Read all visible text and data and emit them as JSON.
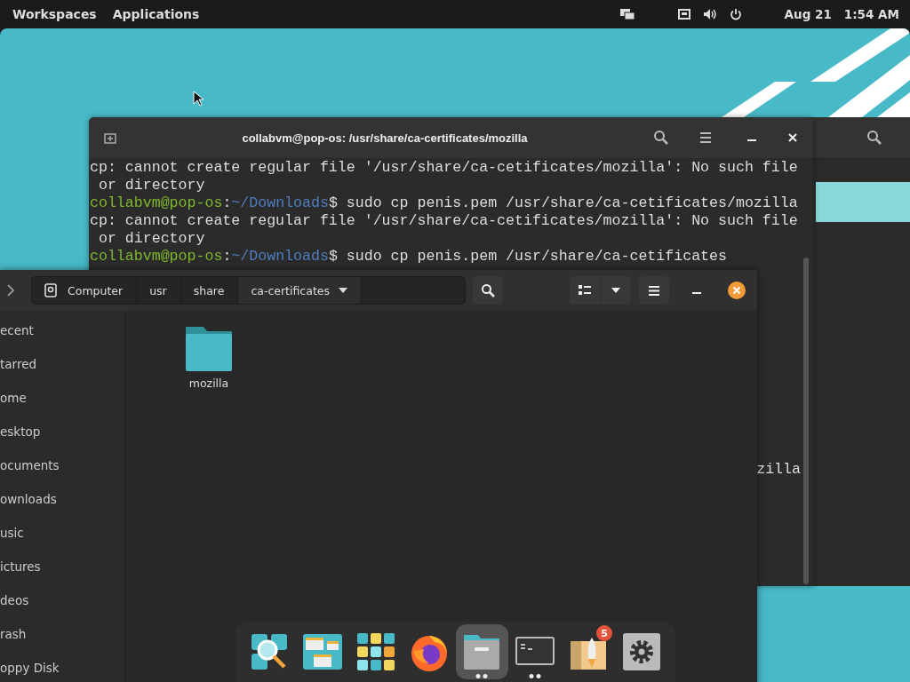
{
  "top_bar": {
    "workspaces": "Workspaces",
    "applications": "Applications",
    "date": "Aug 21",
    "time": "1:54 AM"
  },
  "terminal": {
    "title": "collabvm@pop-os: /usr/share/ca-certificates/mozilla",
    "lines": [
      {
        "kind": "output",
        "text": "cp: cannot create regular file '/usr/share/ca-cetificates/mozilla': No such file"
      },
      {
        "kind": "output",
        "text": " or directory"
      },
      {
        "kind": "prompt",
        "user": "collabvm@pop-os",
        "sep": ":",
        "path": "~/Downloads",
        "command": "$ sudo cp penis.pem /usr/share/ca-cetificates/mozilla"
      },
      {
        "kind": "output",
        "text": "cp: cannot create regular file '/usr/share/ca-cetificates/mozilla': No such file"
      },
      {
        "kind": "output",
        "text": " or directory"
      },
      {
        "kind": "prompt",
        "user": "collabvm@pop-os",
        "sep": ":",
        "path": "~/Downloads",
        "command": "$ sudo cp penis.pem /usr/share/ca-cetificates"
      }
    ],
    "partial_line": "zilla"
  },
  "file_manager": {
    "breadcrumbs": [
      {
        "label": "Computer",
        "kind": "drive",
        "selected": false
      },
      {
        "label": "usr",
        "kind": "folder",
        "selected": false
      },
      {
        "label": "share",
        "kind": "folder",
        "selected": false
      },
      {
        "label": "ca-certificates",
        "kind": "folder",
        "selected": true
      }
    ],
    "sidebar_items": [
      "ecent",
      "tarred",
      "ome",
      "esktop",
      "ocuments",
      "ownloads",
      "usic",
      "ictures",
      "deos",
      "rash",
      "oppy Disk"
    ],
    "files": [
      {
        "name": "mozilla",
        "kind": "folder"
      }
    ]
  },
  "dock": {
    "items": [
      {
        "kind": "search",
        "selected": false,
        "running": false
      },
      {
        "kind": "workspaces",
        "selected": false,
        "running": false
      },
      {
        "kind": "apps",
        "selected": false,
        "running": false
      },
      {
        "kind": "browser",
        "selected": false,
        "running": false
      },
      {
        "kind": "files",
        "selected": true,
        "running": true
      },
      {
        "kind": "terminal",
        "selected": false,
        "running": true
      },
      {
        "kind": "rocket",
        "selected": false,
        "running": false,
        "badge": "5"
      },
      {
        "kind": "settings",
        "selected": false,
        "running": false
      }
    ]
  }
}
